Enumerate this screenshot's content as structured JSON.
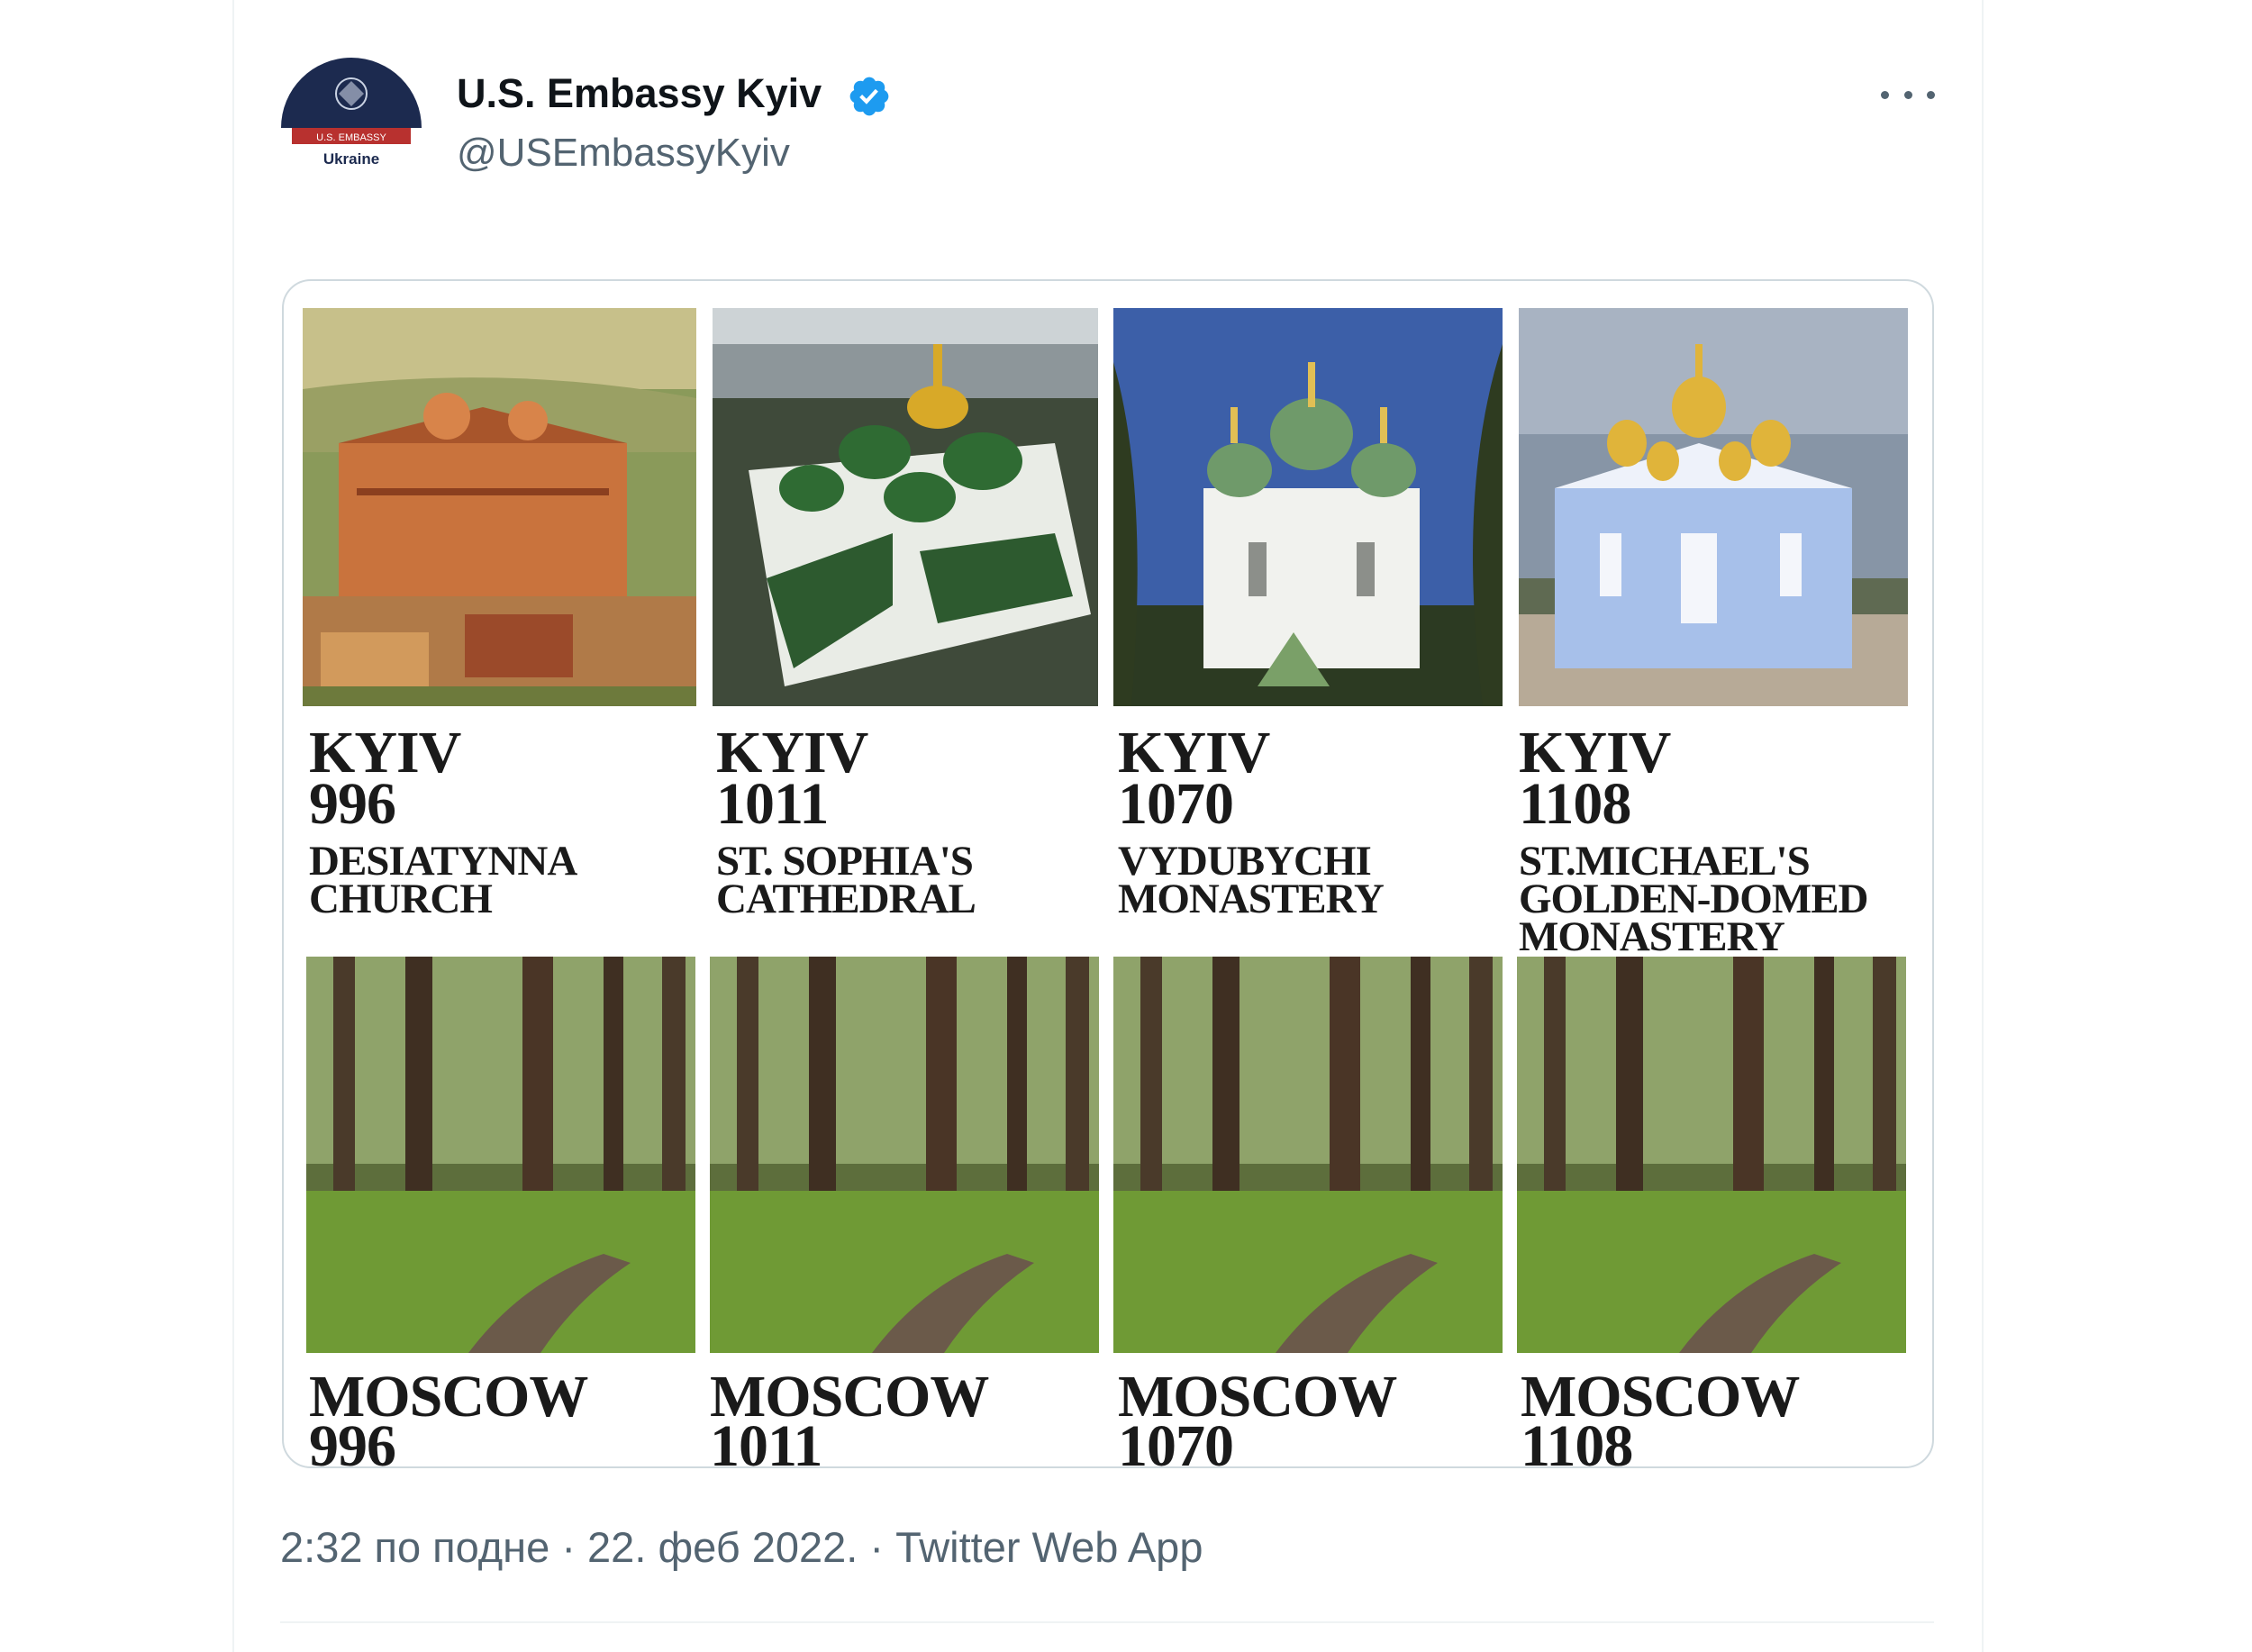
{
  "author": {
    "name": "U.S. Embassy Kyiv",
    "handle": "@USEmbassyKyiv",
    "verified": true,
    "avatar_text_top": "U.S. EMBASSY",
    "avatar_text_bottom": "Ukraine"
  },
  "colors": {
    "verified_blue": "#1d9bf0",
    "text_primary": "#0f1419",
    "text_secondary": "#536471",
    "avatar_navy": "#1c2a4f",
    "avatar_red": "#b8312f"
  },
  "icons": {
    "more": "more-options-icon",
    "verified": "verified-badge-icon"
  },
  "image": {
    "kyiv": [
      {
        "city": "KYIV",
        "year": "996",
        "name_lines": [
          "DESIATYNNA",
          "CHURCH"
        ]
      },
      {
        "city": "KYIV",
        "year": "1011",
        "name_lines": [
          "ST. SOPHIA'S",
          "CATHEDRAL"
        ]
      },
      {
        "city": "KYIV",
        "year": "1070",
        "name_lines": [
          "VYDUBYCHI",
          "MONASTERY"
        ]
      },
      {
        "city": "KYIV",
        "year": "1108",
        "name_lines": [
          "ST.MICHAEL'S",
          "GOLDEN-DOMED",
          "MONASTERY"
        ]
      }
    ],
    "moscow": [
      {
        "city": "MOSCOW",
        "year": "996"
      },
      {
        "city": "MOSCOW",
        "year": "1011"
      },
      {
        "city": "MOSCOW",
        "year": "1070"
      },
      {
        "city": "MOSCOW",
        "year": "1108"
      }
    ]
  },
  "meta": {
    "time": "2:32 по подне",
    "separator_1": " · ",
    "date": "22. феб 2022.",
    "separator_2": " · ",
    "source": "Twitter Web App"
  }
}
